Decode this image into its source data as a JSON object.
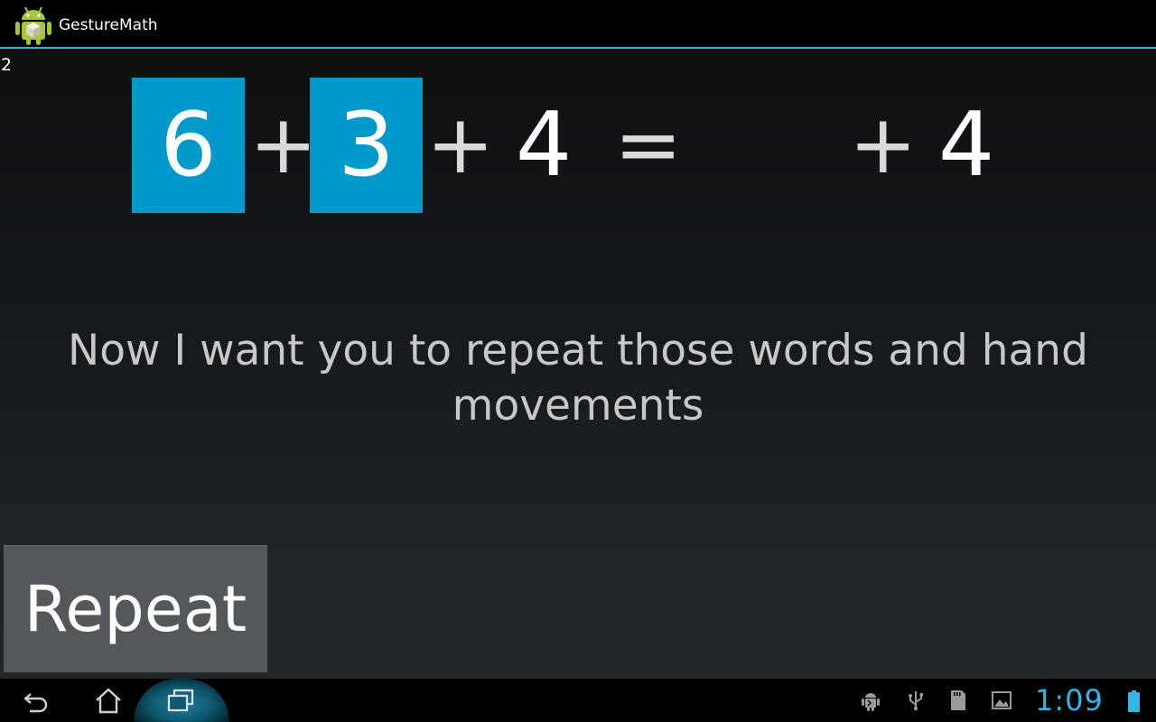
{
  "action_bar": {
    "app_title": "GestureMath",
    "app_icon": "android-icon"
  },
  "counter": "2",
  "equation": {
    "tile1": "6",
    "op1": "+",
    "tile2": "3",
    "op2": "+",
    "num3": "4",
    "equals": "=",
    "op3": "+",
    "num4": "4"
  },
  "instruction": "Now I want you to repeat those words and hand movements",
  "repeat_button": {
    "label": "Repeat"
  },
  "system_bar": {
    "clock": "1:09",
    "icons": [
      "back-icon",
      "home-icon",
      "recent-apps-icon",
      "android-debug-icon",
      "usb-icon",
      "sd-card-icon",
      "image-icon",
      "battery-icon"
    ]
  },
  "colors": {
    "accent": "#33b5e5",
    "tile": "#0099cc",
    "button": "#55585a"
  }
}
